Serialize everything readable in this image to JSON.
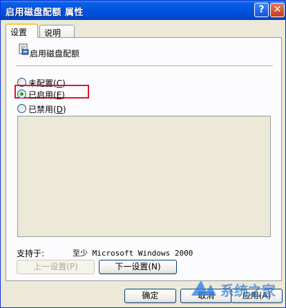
{
  "window": {
    "title": "启用磁盘配额 属性",
    "help_glyph": "?",
    "close_glyph": "✕"
  },
  "tabs": [
    {
      "label": "设置",
      "active": true
    },
    {
      "label": "说明",
      "active": false
    }
  ],
  "policy": {
    "name": "启用磁盘配额",
    "icon": "policy-icon"
  },
  "options": [
    {
      "label": "未配置",
      "hotkey": "C",
      "checked": false
    },
    {
      "label": "已启用",
      "hotkey": "E",
      "checked": true
    },
    {
      "label": "已禁用",
      "hotkey": "D",
      "checked": false
    }
  ],
  "supported": {
    "label": "支持于:",
    "value": "至少 Microsoft Windows 2000"
  },
  "nav": {
    "prev_label": "上一设置(P)",
    "next_label": "下一设置(N)"
  },
  "footer": {
    "ok_label": "确定",
    "cancel_label": "取消",
    "apply_label": "应用(A)"
  },
  "watermark": {
    "text": "系统之家"
  },
  "colors": {
    "title_bar": "#0054e3",
    "highlight_box": "#e0141e",
    "dialog_bg": "#ece9d8"
  }
}
